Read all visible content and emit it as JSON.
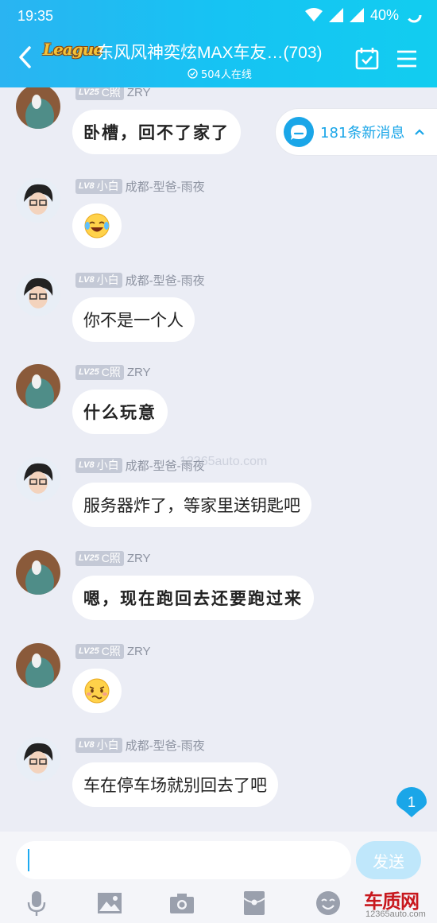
{
  "status_bar": {
    "time": "19:35",
    "battery": "40%"
  },
  "header": {
    "logo_text": "League",
    "title": "东风风神奕炫MAX车友…(703)",
    "online": "504人在线"
  },
  "new_messages": {
    "label": "181条新消息"
  },
  "messages": [
    {
      "level": "LV25",
      "title": "C照",
      "nick": "ZRY",
      "text": "卧槽，回不了家了"
    },
    {
      "level": "LV8",
      "title": "小白",
      "nick": "成都-型爸-雨夜",
      "emoji": "tears-of-joy"
    },
    {
      "level": "LV8",
      "title": "小白",
      "nick": "成都-型爸-雨夜",
      "text": "你不是一个人"
    },
    {
      "level": "LV25",
      "title": "C照",
      "nick": "ZRY",
      "text": "什么玩意"
    },
    {
      "level": "LV8",
      "title": "小白",
      "nick": "成都-型爸-雨夜",
      "text": "服务器炸了，等家里送钥匙吧"
    },
    {
      "level": "LV25",
      "title": "C照",
      "nick": "ZRY",
      "text": "嗯，现在跑回去还要跑过来"
    },
    {
      "level": "LV25",
      "title": "C照",
      "nick": "ZRY",
      "emoji": "awkward"
    },
    {
      "level": "LV8",
      "title": "小白",
      "nick": "成都-型爸-雨夜",
      "text": "车在停车场就别回去了吧"
    }
  ],
  "watermark": "12365auto.com",
  "unread_count": "1",
  "input": {
    "value": "",
    "send_label": "发送"
  },
  "toolbar": [
    "microphone-icon",
    "image-icon",
    "camera-icon",
    "red-packet-icon",
    "emoji-icon"
  ],
  "corner_mark": {
    "title": "车质网",
    "url": "12365auto.com"
  },
  "colors": {
    "header": "#19bdf2",
    "accent": "#1aa6e8",
    "bubble": "#ffffff",
    "background": "#ebedf5"
  }
}
